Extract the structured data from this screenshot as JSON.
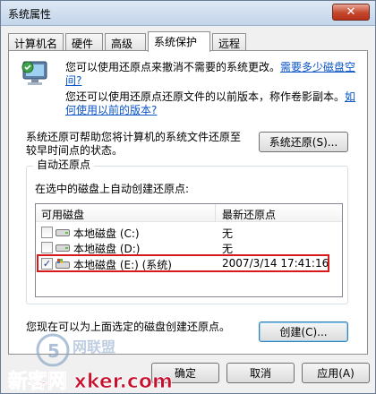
{
  "window": {
    "title": "系统属性",
    "close_label": "✕"
  },
  "tabs": [
    {
      "label": "计算机名"
    },
    {
      "label": "硬件"
    },
    {
      "label": "高级"
    },
    {
      "label": "系统保护",
      "active": true
    },
    {
      "label": "远程"
    }
  ],
  "intro": {
    "line1": "您可以使用还原点来撤消不需要的系统更改。",
    "line1_link": "需要多少磁盘空",
    "line1_link_cont": "间?",
    "line2": "您还可以使用还原点还原文件的以前版本，称作卷影副本。",
    "line2_link": "如",
    "line2_link_cont": "何使用以前的版本?"
  },
  "restore": {
    "text_line1": "系统还原可帮助您将计算机的系统文件还原至",
    "text_line2": "较早时间点的状态。",
    "button_label": "系统还原(S)..."
  },
  "auto_restore": {
    "group_label": "自动还原点",
    "subtitle": "在选中的磁盘上自动创建还原点:",
    "columns": [
      "可用磁盘",
      "最新还原点"
    ],
    "rows": [
      {
        "disk": "本地磁盘 (C:)",
        "latest": "无",
        "checked": false
      },
      {
        "disk": "本地磁盘 (D:)",
        "latest": "无",
        "checked": false
      },
      {
        "disk": "本地磁盘 (E:) (系统)",
        "latest": "2007/3/14 17:41:16",
        "checked": true
      }
    ]
  },
  "create": {
    "text": "您现在可以为上面选定的磁盘创建还原点。",
    "button_label": "创建(C)..."
  },
  "footer": {
    "ok_label": "确定",
    "cancel_label": "取消",
    "apply_label": "应用(A)"
  },
  "watermark": {
    "text": "新客网 xker.com"
  },
  "colors": {
    "link": "#0b55c4",
    "highlight": "#d8191c",
    "watermark": "#c8102e"
  }
}
